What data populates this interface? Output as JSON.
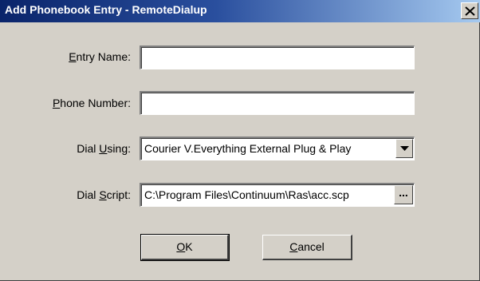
{
  "window": {
    "title": "Add Phonebook Entry - RemoteDialup",
    "close_glyph": "×"
  },
  "form": {
    "entry_name": {
      "label_mnemonic": "E",
      "label_rest": "ntry Name:",
      "value": ""
    },
    "phone_number": {
      "label_mnemonic": "P",
      "label_rest": "hone Number:",
      "value": ""
    },
    "dial_using": {
      "label_prefix": "Dial ",
      "label_mnemonic": "U",
      "label_rest": "sing:",
      "selected": "Courier V.Everything External Plug & Play"
    },
    "dial_script": {
      "label_prefix": "Dial ",
      "label_mnemonic": "S",
      "label_rest": "cript:",
      "value": "C:\\Program Files\\Continuum\\Ras\\acc.scp",
      "browse_label": "..."
    }
  },
  "buttons": {
    "ok": {
      "mnemonic": "O",
      "rest": "K"
    },
    "cancel": {
      "mnemonic": "C",
      "rest": "ancel"
    }
  },
  "icons": {
    "close": "close-icon",
    "dropdown": "chevron-down-icon"
  },
  "colors": {
    "titlebar_start": "#0a246a",
    "titlebar_end": "#a6caf0",
    "dialog_face": "#d4d0c8"
  }
}
